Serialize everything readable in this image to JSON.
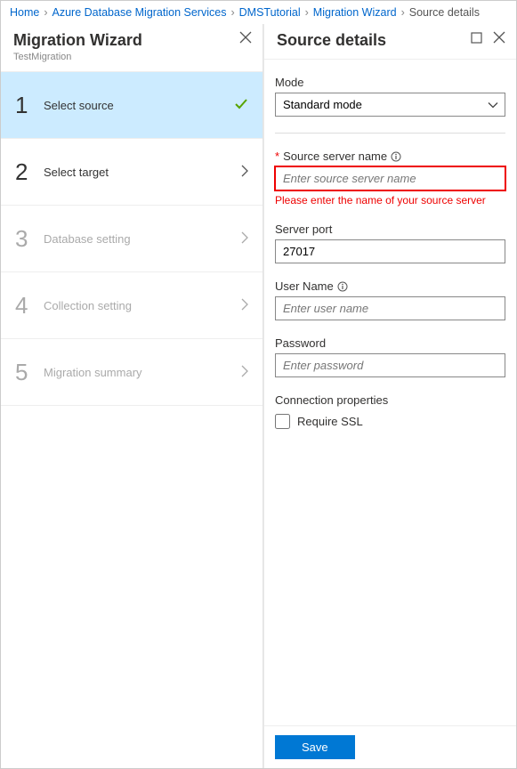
{
  "breadcrumb": {
    "home": "Home",
    "svc": "Azure Database Migration Services",
    "tutorial": "DMSTutorial",
    "wizard": "Migration Wizard",
    "current": "Source details"
  },
  "left": {
    "title": "Migration Wizard",
    "subtitle": "TestMigration",
    "steps": [
      {
        "num": "1",
        "label": "Select source"
      },
      {
        "num": "2",
        "label": "Select target"
      },
      {
        "num": "3",
        "label": "Database setting"
      },
      {
        "num": "4",
        "label": "Collection setting"
      },
      {
        "num": "5",
        "label": "Migration summary"
      }
    ]
  },
  "right": {
    "title": "Source details",
    "mode_label": "Mode",
    "mode_value": "Standard mode",
    "source_server_label": "Source server name",
    "source_server_placeholder": "Enter source server name",
    "source_server_error": "Please enter the name of your source server",
    "server_port_label": "Server port",
    "server_port_value": "27017",
    "user_name_label": "User Name",
    "user_name_placeholder": "Enter user name",
    "password_label": "Password",
    "password_placeholder": "Enter password",
    "conn_props_label": "Connection properties",
    "require_ssl_label": "Require SSL",
    "save_label": "Save"
  }
}
